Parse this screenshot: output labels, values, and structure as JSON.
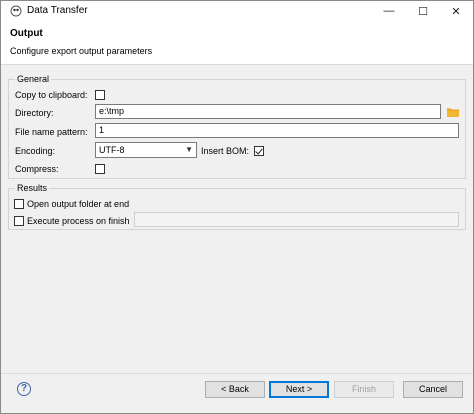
{
  "window": {
    "title": "Data Transfer",
    "minimize_glyph": "—",
    "maximize_glyph": "☐",
    "close_glyph": "✕"
  },
  "header": {
    "title": "Output",
    "subtitle": "Configure export output parameters"
  },
  "general": {
    "label": "General",
    "copy_to_clipboard": {
      "label": "Copy to clipboard:",
      "checked": false
    },
    "directory": {
      "label": "Directory:",
      "value": "e:\\tmp",
      "icon": "folder-icon"
    },
    "file_name_pattern": {
      "label": "File name pattern:",
      "value": "1"
    },
    "encoding": {
      "label": "Encoding:",
      "value": "UTF-8"
    },
    "insert_bom": {
      "label": "Insert BOM:",
      "checked": true
    },
    "compress": {
      "label": "Compress:",
      "checked": false
    }
  },
  "results": {
    "label": "Results",
    "open_output_folder": {
      "label": "Open output folder at end",
      "checked": false
    },
    "execute_process": {
      "label": "Execute process on finish",
      "checked": false,
      "value": ""
    }
  },
  "footer": {
    "help_glyph": "?",
    "back_label": "< Back",
    "next_label": "Next >",
    "finish_label": "Finish",
    "cancel_label": "Cancel"
  },
  "colors": {
    "accent": "#0078d7",
    "folder": "#e8a317"
  }
}
